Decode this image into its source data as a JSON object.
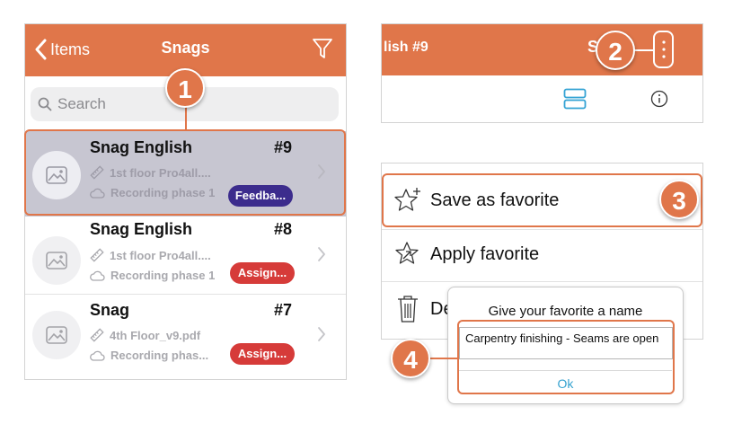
{
  "snags_list": {
    "back_label": "Items",
    "title": "Snags",
    "search_placeholder": "Search",
    "rows": [
      {
        "title": "Snag English",
        "number": "#9",
        "location": "1st floor Pro4all....",
        "phase": "Recording phase 1",
        "badge": "Feedba...",
        "badge_color": "#3c2c8d",
        "selected": true
      },
      {
        "title": "Snag English",
        "number": "#8",
        "location": "1st floor Pro4all....",
        "phase": "Recording phase 1",
        "badge": "Assign...",
        "badge_color": "#d63b39",
        "selected": false
      },
      {
        "title": "Snag",
        "number": "#7",
        "location": "4th Floor_v9.pdf",
        "phase": "Recording phas...",
        "badge": "Assign...",
        "badge_color": "#d63b39",
        "selected": false
      }
    ]
  },
  "detail_header": {
    "title_fragment": "lish #9",
    "title_fragment_2": "S"
  },
  "menu": {
    "items": [
      {
        "label": "Save as favorite",
        "icon": "star-plus-icon"
      },
      {
        "label": "Apply favorite",
        "icon": "star-arrow-icon"
      },
      {
        "label": "De",
        "icon": "trash-icon"
      }
    ]
  },
  "dialog": {
    "title": "Give your favorite a name",
    "input_value": "Carpentry finishing - Seams are open",
    "ok_label": "Ok"
  },
  "callouts": [
    "1",
    "2",
    "3",
    "4"
  ],
  "colors": {
    "accent": "#e0764a",
    "selected_row": "#c7c6d1",
    "ok_link": "#35a2cf"
  }
}
